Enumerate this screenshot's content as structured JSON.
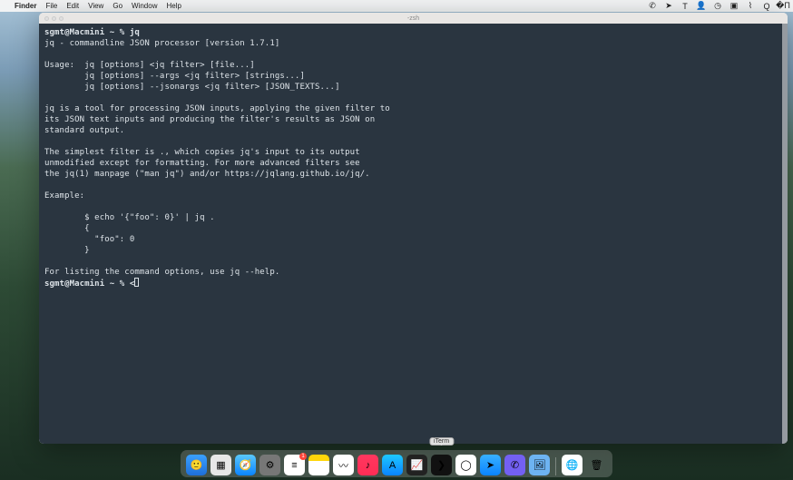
{
  "menubar": {
    "app": "Finder",
    "items": [
      "File",
      "Edit",
      "View",
      "Go",
      "Window",
      "Help"
    ],
    "status_icons": [
      "viber",
      "send",
      "text",
      "person",
      "clock",
      "cc",
      "wifi",
      "search",
      "control"
    ]
  },
  "terminal": {
    "title": "-zsh",
    "prompt1": "sgmt@Macmini ~ % ",
    "cmd1": "jq",
    "lines": [
      "jq - commandline JSON processor [version 1.7.1]",
      "",
      "Usage:  jq [options] <jq filter> [file...]",
      "        jq [options] --args <jq filter> [strings...]",
      "        jq [options] --jsonargs <jq filter> [JSON_TEXTS...]",
      "",
      "jq is a tool for processing JSON inputs, applying the given filter to",
      "its JSON text inputs and producing the filter's results as JSON on",
      "standard output.",
      "",
      "The simplest filter is ., which copies jq's input to its output",
      "unmodified except for formatting. For more advanced filters see",
      "the jq(1) manpage (\"man jq\") and/or https://jqlang.github.io/jq/.",
      "",
      "Example:",
      "",
      "        $ echo '{\"foo\": 0}' | jq .",
      "        {",
      "          \"foo\": 0",
      "        }",
      "",
      "For listing the command options, use jq --help."
    ],
    "prompt2": "sgmt@Macmini ~ % ",
    "cmd2": "<"
  },
  "dock": {
    "items": [
      {
        "name": "finder",
        "bg": "linear-gradient(#3aa0ff,#1e6fd9)",
        "glyph": "🙂"
      },
      {
        "name": "launchpad",
        "bg": "#e7e7e7",
        "glyph": "▦"
      },
      {
        "name": "safari",
        "bg": "linear-gradient(#5ac8fa,#0a84ff)",
        "glyph": "🧭"
      },
      {
        "name": "settings",
        "bg": "#777",
        "glyph": "⚙"
      },
      {
        "name": "reminders",
        "bg": "#fff",
        "glyph": "≡",
        "badge": "1"
      },
      {
        "name": "notes",
        "bg": "linear-gradient(#ffd60a 30%,#fff 30%)",
        "glyph": ""
      },
      {
        "name": "freeform",
        "bg": "#fff",
        "glyph": "〰"
      },
      {
        "name": "music",
        "bg": "linear-gradient(#ff375f,#ff2d55)",
        "glyph": "♪"
      },
      {
        "name": "appstore",
        "bg": "linear-gradient(#1ec8ff,#0a84ff)",
        "glyph": "A"
      },
      {
        "name": "activity",
        "bg": "#222",
        "glyph": "📈"
      },
      {
        "name": "iterm",
        "bg": "#111",
        "glyph": "❯",
        "tooltip": "iTerm"
      },
      {
        "name": "arc",
        "bg": "#fff",
        "glyph": "◯"
      },
      {
        "name": "telegram",
        "bg": "linear-gradient(#38b0ff,#0a84ff)",
        "glyph": "➤"
      },
      {
        "name": "viber",
        "bg": "#7360f2",
        "glyph": "✆"
      },
      {
        "name": "preview",
        "bg": "#6db3f2",
        "glyph": "🖼"
      }
    ],
    "after_sep": [
      {
        "name": "globe",
        "bg": "#fff",
        "glyph": "🌐"
      },
      {
        "name": "trash",
        "bg": "transparent",
        "glyph": "🗑"
      }
    ]
  }
}
